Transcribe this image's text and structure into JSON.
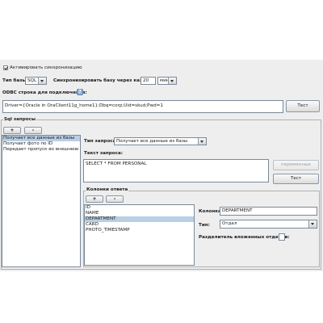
{
  "sync": {
    "enabled_label": "Активировать синхронизацию",
    "enabled": true,
    "db_type_label": "Тип базы:",
    "db_type_value": "SQL",
    "sync_every_label": "Синхронизировать базу через каждые",
    "sync_interval": "20",
    "sync_unit": "мин"
  },
  "odbc": {
    "label": "ODBC строка для подключения:",
    "help_icon": "question-icon",
    "value": "Driver={Oracle in OraClient11g_home1};Dbq=corp;Uid=skud;Pwd=1",
    "test_button": "Тест"
  },
  "sql": {
    "group_title": "Sql запросы",
    "add_button": "+",
    "remove_button": "-",
    "queries": [
      {
        "label": "Получает все данные из базы",
        "selected": true
      },
      {
        "label": "Получает фото по ID",
        "selected": false
      },
      {
        "label": "Передает пропуск во внешнюю базу",
        "selected": false
      }
    ],
    "query_type_label": "Тип запроса:",
    "query_type_value": "Получает все данные из базы",
    "query_text_label": "Текст запроса:",
    "query_text_value": "SELECT * FROM PERSONAL",
    "variables_button": "переменные",
    "test_button": "Тест"
  },
  "response": {
    "group_title": "Колонки ответа",
    "add_button": "+",
    "remove_button": "-",
    "columns": [
      {
        "label": "ID",
        "selected": false
      },
      {
        "label": "NAME",
        "selected": false
      },
      {
        "label": "DEPARTMENT",
        "selected": true
      },
      {
        "label": "CARD",
        "selected": false
      },
      {
        "label": "PHOTO_TIMESTAMP",
        "selected": false
      }
    ],
    "column_label": "Колонка:",
    "column_value": "DEPARTMENT",
    "type_label": "Тип:",
    "type_value": "Отдел",
    "separator_label": "Разделитель вложенных отделов:",
    "separator_value": ""
  }
}
